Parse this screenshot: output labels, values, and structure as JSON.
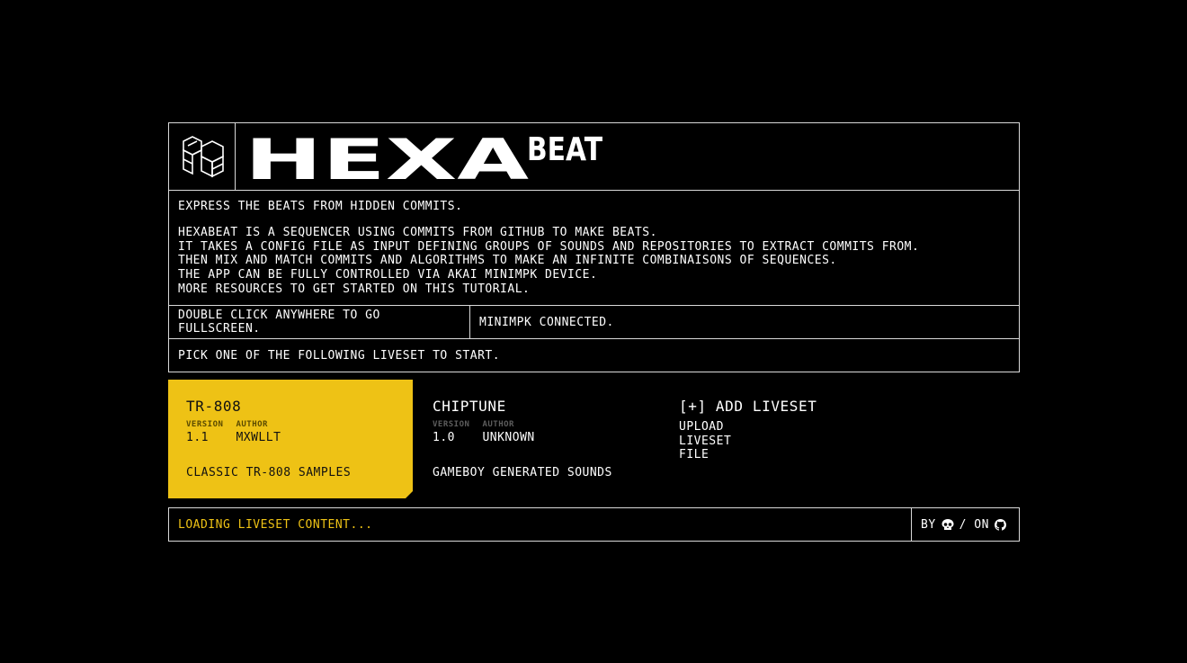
{
  "header": {
    "logo_icon": "hexabeat-hex-logo-icon",
    "wordmark_main": "HEXA",
    "wordmark_sub": "BEAT"
  },
  "intro": {
    "tagline": "EXPRESS THE BEATS FROM HIDDEN COMMITS.",
    "lines": [
      "HEXABEAT IS A SEQUENCER USING COMMITS FROM GITHUB TO MAKE BEATS.",
      "IT TAKES A CONFIG FILE AS INPUT DEFINING GROUPS OF SOUNDS AND REPOSITORIES TO EXTRACT COMMITS FROM.",
      "THEN MIX AND MATCH COMMITS AND ALGORITHMS TO MAKE AN INFINITE COMBINAISONS OF SEQUENCES.",
      "THE APP CAN BE FULLY CONTROLLED VIA AKAI MINIMPK DEVICE.",
      "MORE RESOURCES TO GET STARTED ON THIS TUTORIAL."
    ]
  },
  "status": {
    "fullscreen_hint": "DOUBLE CLICK ANYWHERE TO GO FULLSCREEN.",
    "device": "MINIMPK CONNECTED."
  },
  "pick": "PICK ONE OF THE FOLLOWING LIVESET TO START.",
  "livesets": [
    {
      "name": "TR-808",
      "version_label": "VERSION",
      "author_label": "AUTHOR",
      "version": "1.1",
      "author": "MXWLLT",
      "description": "CLASSIC TR-808 SAMPLES",
      "selected": true
    },
    {
      "name": "CHIPTUNE",
      "version_label": "VERSION",
      "author_label": "AUTHOR",
      "version": "1.0",
      "author": "UNKNOWN",
      "description": "GAMEBOY GENERATED SOUNDS",
      "selected": false
    }
  ],
  "add_liveset": {
    "title": "[+] ADD LIVESET",
    "upload": "UPLOAD LIVESET FILE"
  },
  "footer": {
    "loading": "LOADING LIVESET CONTENT...",
    "by": "BY",
    "separator": "/ ON",
    "author_icon": "skull-icon",
    "github_icon": "github-icon"
  },
  "colors": {
    "background": "#000000",
    "accent": "#eec215",
    "border": "#d9d9d9",
    "text": "#ffffff"
  }
}
